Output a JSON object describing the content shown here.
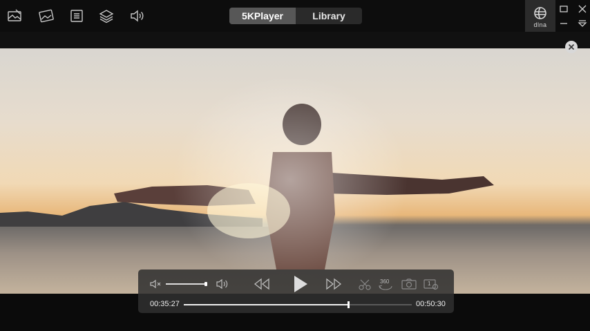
{
  "header": {
    "tabs": [
      {
        "label": "5KPlayer",
        "active": true
      },
      {
        "label": "Library",
        "active": false
      }
    ],
    "dlna_label": "dlna",
    "left_icons": [
      "youtube-download-icon",
      "airplay-icon",
      "playlist-icon",
      "layers-icon",
      "audio-icon"
    ]
  },
  "controls": {
    "current_time": "00:35:27",
    "total_time": "00:50:30",
    "progress": 0.72,
    "volume": 1.0,
    "badge_360": "360",
    "badge_speed": "1"
  },
  "colors": {
    "bar_bg": "#0d0d0d",
    "active_tab": "#575757",
    "controls_bg": "#303030"
  }
}
